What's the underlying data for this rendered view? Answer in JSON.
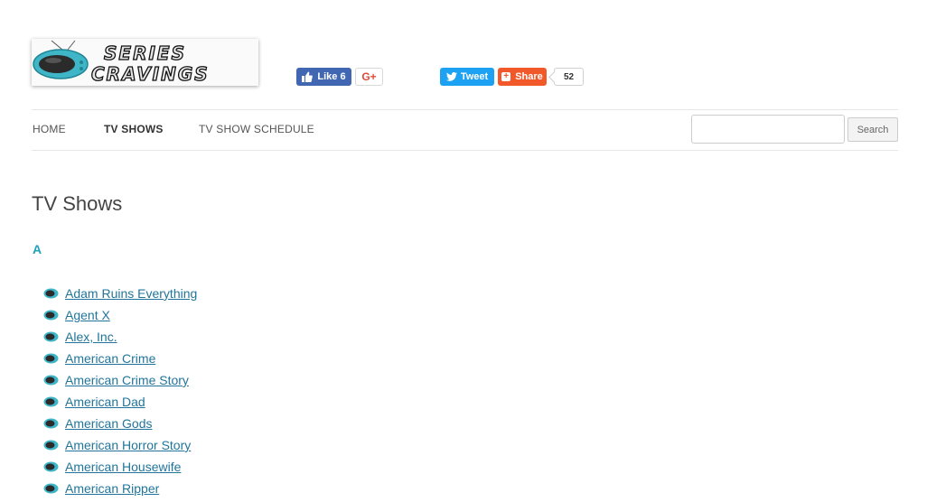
{
  "header": {
    "logo_line1": "SERIES",
    "logo_line2": "CRAVINGS"
  },
  "social": {
    "like_label": "Like 6",
    "gplus_label": "G+",
    "tweet_label": "Tweet",
    "share_label": "Share",
    "share_count": "52",
    "colors": {
      "facebook": "#4267b2",
      "twitter": "#1da1f2",
      "share": "#f1592a",
      "gplus": "#dd4b39"
    }
  },
  "nav": {
    "items": [
      {
        "label": "HOME",
        "active": false
      },
      {
        "label": "TV SHOWS",
        "active": true
      },
      {
        "label": "TV SHOW SCHEDULE",
        "active": false
      }
    ],
    "search": {
      "value": "",
      "button_label": "Search"
    }
  },
  "content": {
    "title": "TV Shows",
    "letter": "A",
    "accent_color": "#1ea2bd",
    "link_color": "#21759b",
    "shows": [
      "Adam Ruins Everything",
      "Agent X",
      "Alex, Inc.",
      "American Crime",
      "American Crime Story",
      "American Dad",
      "American Gods",
      "American Horror Story",
      "American Housewife",
      "American Ripper"
    ]
  },
  "icons": {
    "bullet": "tv-icon",
    "like": "thumbs-up-icon",
    "tweet": "twitter-bird-icon",
    "share": "plus-icon"
  }
}
